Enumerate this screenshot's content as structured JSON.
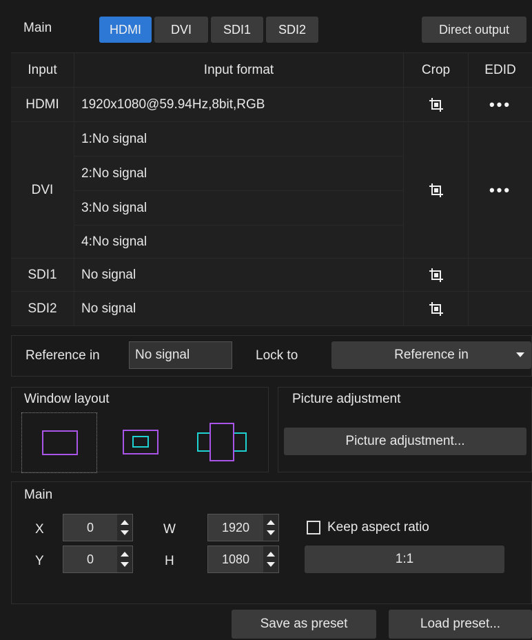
{
  "header": {
    "main_label": "Main",
    "tabs": [
      "HDMI",
      "DVI",
      "SDI1",
      "SDI2"
    ],
    "active_tab": "HDMI",
    "direct_output": "Direct output"
  },
  "table": {
    "columns": [
      "Input",
      "Input format",
      "Crop",
      "EDID"
    ],
    "rows": {
      "hdmi": {
        "input": "HDMI",
        "format": "1920x1080@59.94Hz,8bit,RGB",
        "edid": "•••"
      },
      "dvi": {
        "input": "DVI",
        "formats": [
          "1:No signal",
          "2:No signal",
          "3:No signal",
          "4:No signal"
        ],
        "edid": "•••"
      },
      "sdi1": {
        "input": "SDI1",
        "format": "No signal"
      },
      "sdi2": {
        "input": "SDI2",
        "format": "No signal"
      }
    }
  },
  "reference": {
    "label": "Reference in",
    "value": "No signal",
    "lock_label": "Lock to",
    "lock_value": "Reference in"
  },
  "window_layout": {
    "title": "Window layout"
  },
  "picture_adjustment": {
    "title": "Picture adjustment",
    "button": "Picture adjustment..."
  },
  "main_position": {
    "title": "Main",
    "x_label": "X",
    "x_value": "0",
    "y_label": "Y",
    "y_value": "0",
    "w_label": "W",
    "w_value": "1920",
    "h_label": "H",
    "h_value": "1080",
    "keep_aspect": "Keep aspect ratio",
    "ratio_button": "1:1"
  },
  "footer": {
    "save_preset": "Save as preset",
    "load_preset": "Load preset..."
  },
  "colors": {
    "accent": "#2d78d4",
    "layout_outer": "#a855e8",
    "layout_inner": "#1fd1d1"
  }
}
